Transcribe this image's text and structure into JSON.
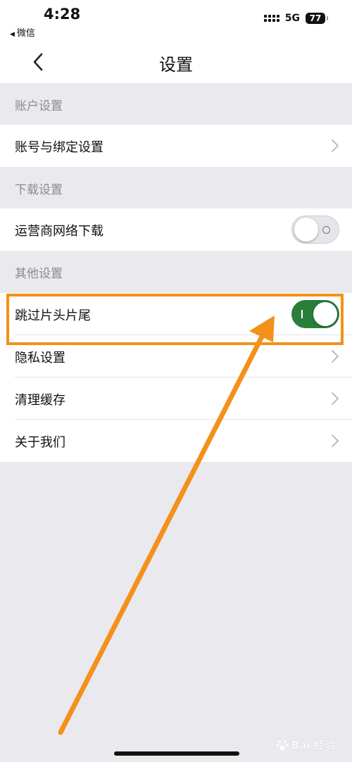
{
  "status_bar": {
    "time": "4:28",
    "back_app": "微信",
    "network": "5G",
    "battery": "77"
  },
  "nav": {
    "title": "设置"
  },
  "sections": [
    {
      "header": "账户设置",
      "rows": [
        {
          "label": "账号与绑定设置",
          "control": "chevron"
        }
      ]
    },
    {
      "header": "下载设置",
      "rows": [
        {
          "label": "运营商网络下载",
          "control": "toggle",
          "value": "off"
        }
      ]
    },
    {
      "header": "其他设置",
      "rows": [
        {
          "label": "跳过片头片尾",
          "control": "toggle",
          "value": "on"
        },
        {
          "label": "隐私设置",
          "control": "chevron"
        },
        {
          "label": "清理缓存",
          "control": "chevron"
        },
        {
          "label": "关于我们",
          "control": "chevron"
        }
      ]
    }
  ],
  "watermark": {
    "text": "Bai 经验"
  },
  "colors": {
    "accent_toggle_on": "#2a7d3b",
    "annotation_orange": "#f39119",
    "page_background": "#e9e9ee",
    "section_header_text": "#8c8c8c"
  },
  "icons": {
    "back": "chevron-left-icon",
    "row_arrow": "chevron-right-icon",
    "signal": "cellular-signal-icon",
    "battery": "battery-icon"
  }
}
